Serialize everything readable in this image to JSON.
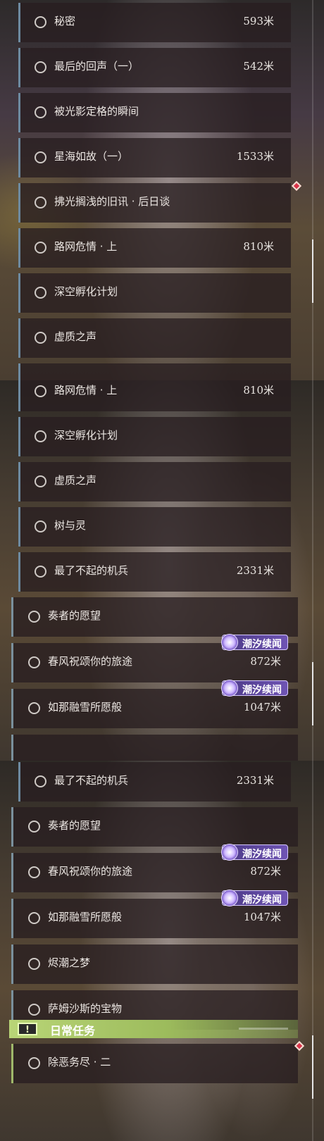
{
  "panels": [
    {
      "rows": [
        {
          "title": "秘密",
          "distance": "593米"
        },
        {
          "title": "最后的回声（一）",
          "distance": "542米"
        },
        {
          "title": "被光影定格的瞬间",
          "distance": ""
        },
        {
          "title": "星海如故（一）",
          "distance": "1533米"
        },
        {
          "title": "拂光搁浅的旧讯 · 后日谈",
          "distance": ""
        },
        {
          "title": "路网危情 · 上",
          "distance": "810米"
        },
        {
          "title": "深空孵化计划",
          "distance": ""
        },
        {
          "title": "虚质之声",
          "distance": ""
        }
      ]
    },
    {
      "rows": [
        {
          "title": "路网危情 · 上",
          "distance": "810米"
        },
        {
          "title": "深空孵化计划",
          "distance": ""
        },
        {
          "title": "虚质之声",
          "distance": ""
        },
        {
          "title": "树与灵",
          "distance": ""
        },
        {
          "title": "最了不起的机兵",
          "distance": "2331米"
        },
        {
          "title": "奏者的愿望",
          "distance": ""
        },
        {
          "title": "春风祝颂你的旅途",
          "distance": "872米",
          "badge": "潮汐续闻"
        },
        {
          "title": "如那融雪所愿般",
          "distance": "1047米",
          "badge": "潮汐续闻"
        }
      ]
    },
    {
      "rows": [
        {
          "title": "最了不起的机兵",
          "distance": "2331米"
        },
        {
          "title": "奏者的愿望",
          "distance": ""
        },
        {
          "title": "春风祝颂你的旅途",
          "distance": "872米",
          "badge": "潮汐续闻"
        },
        {
          "title": "如那融雪所愿般",
          "distance": "1047米",
          "badge": "潮汐续闻"
        },
        {
          "title": "烬潮之梦",
          "distance": ""
        },
        {
          "title": "萨姆沙斯的宝物",
          "distance": ""
        }
      ],
      "section": {
        "icon": "!",
        "title": "日常任务"
      },
      "daily_rows": [
        {
          "title": "除恶务尽 · 二",
          "distance": ""
        }
      ]
    }
  ],
  "colors": {
    "accent_border": "#6d8aa0",
    "daily_accent": "#b9d577",
    "badge": "#6f54b4",
    "marker": "#d9344a"
  },
  "icons": {
    "row": "circle-outline-icon",
    "badge": "tide-sparkle-icon",
    "marker": "red-diamond-icon",
    "section": "exclamation-icon"
  }
}
